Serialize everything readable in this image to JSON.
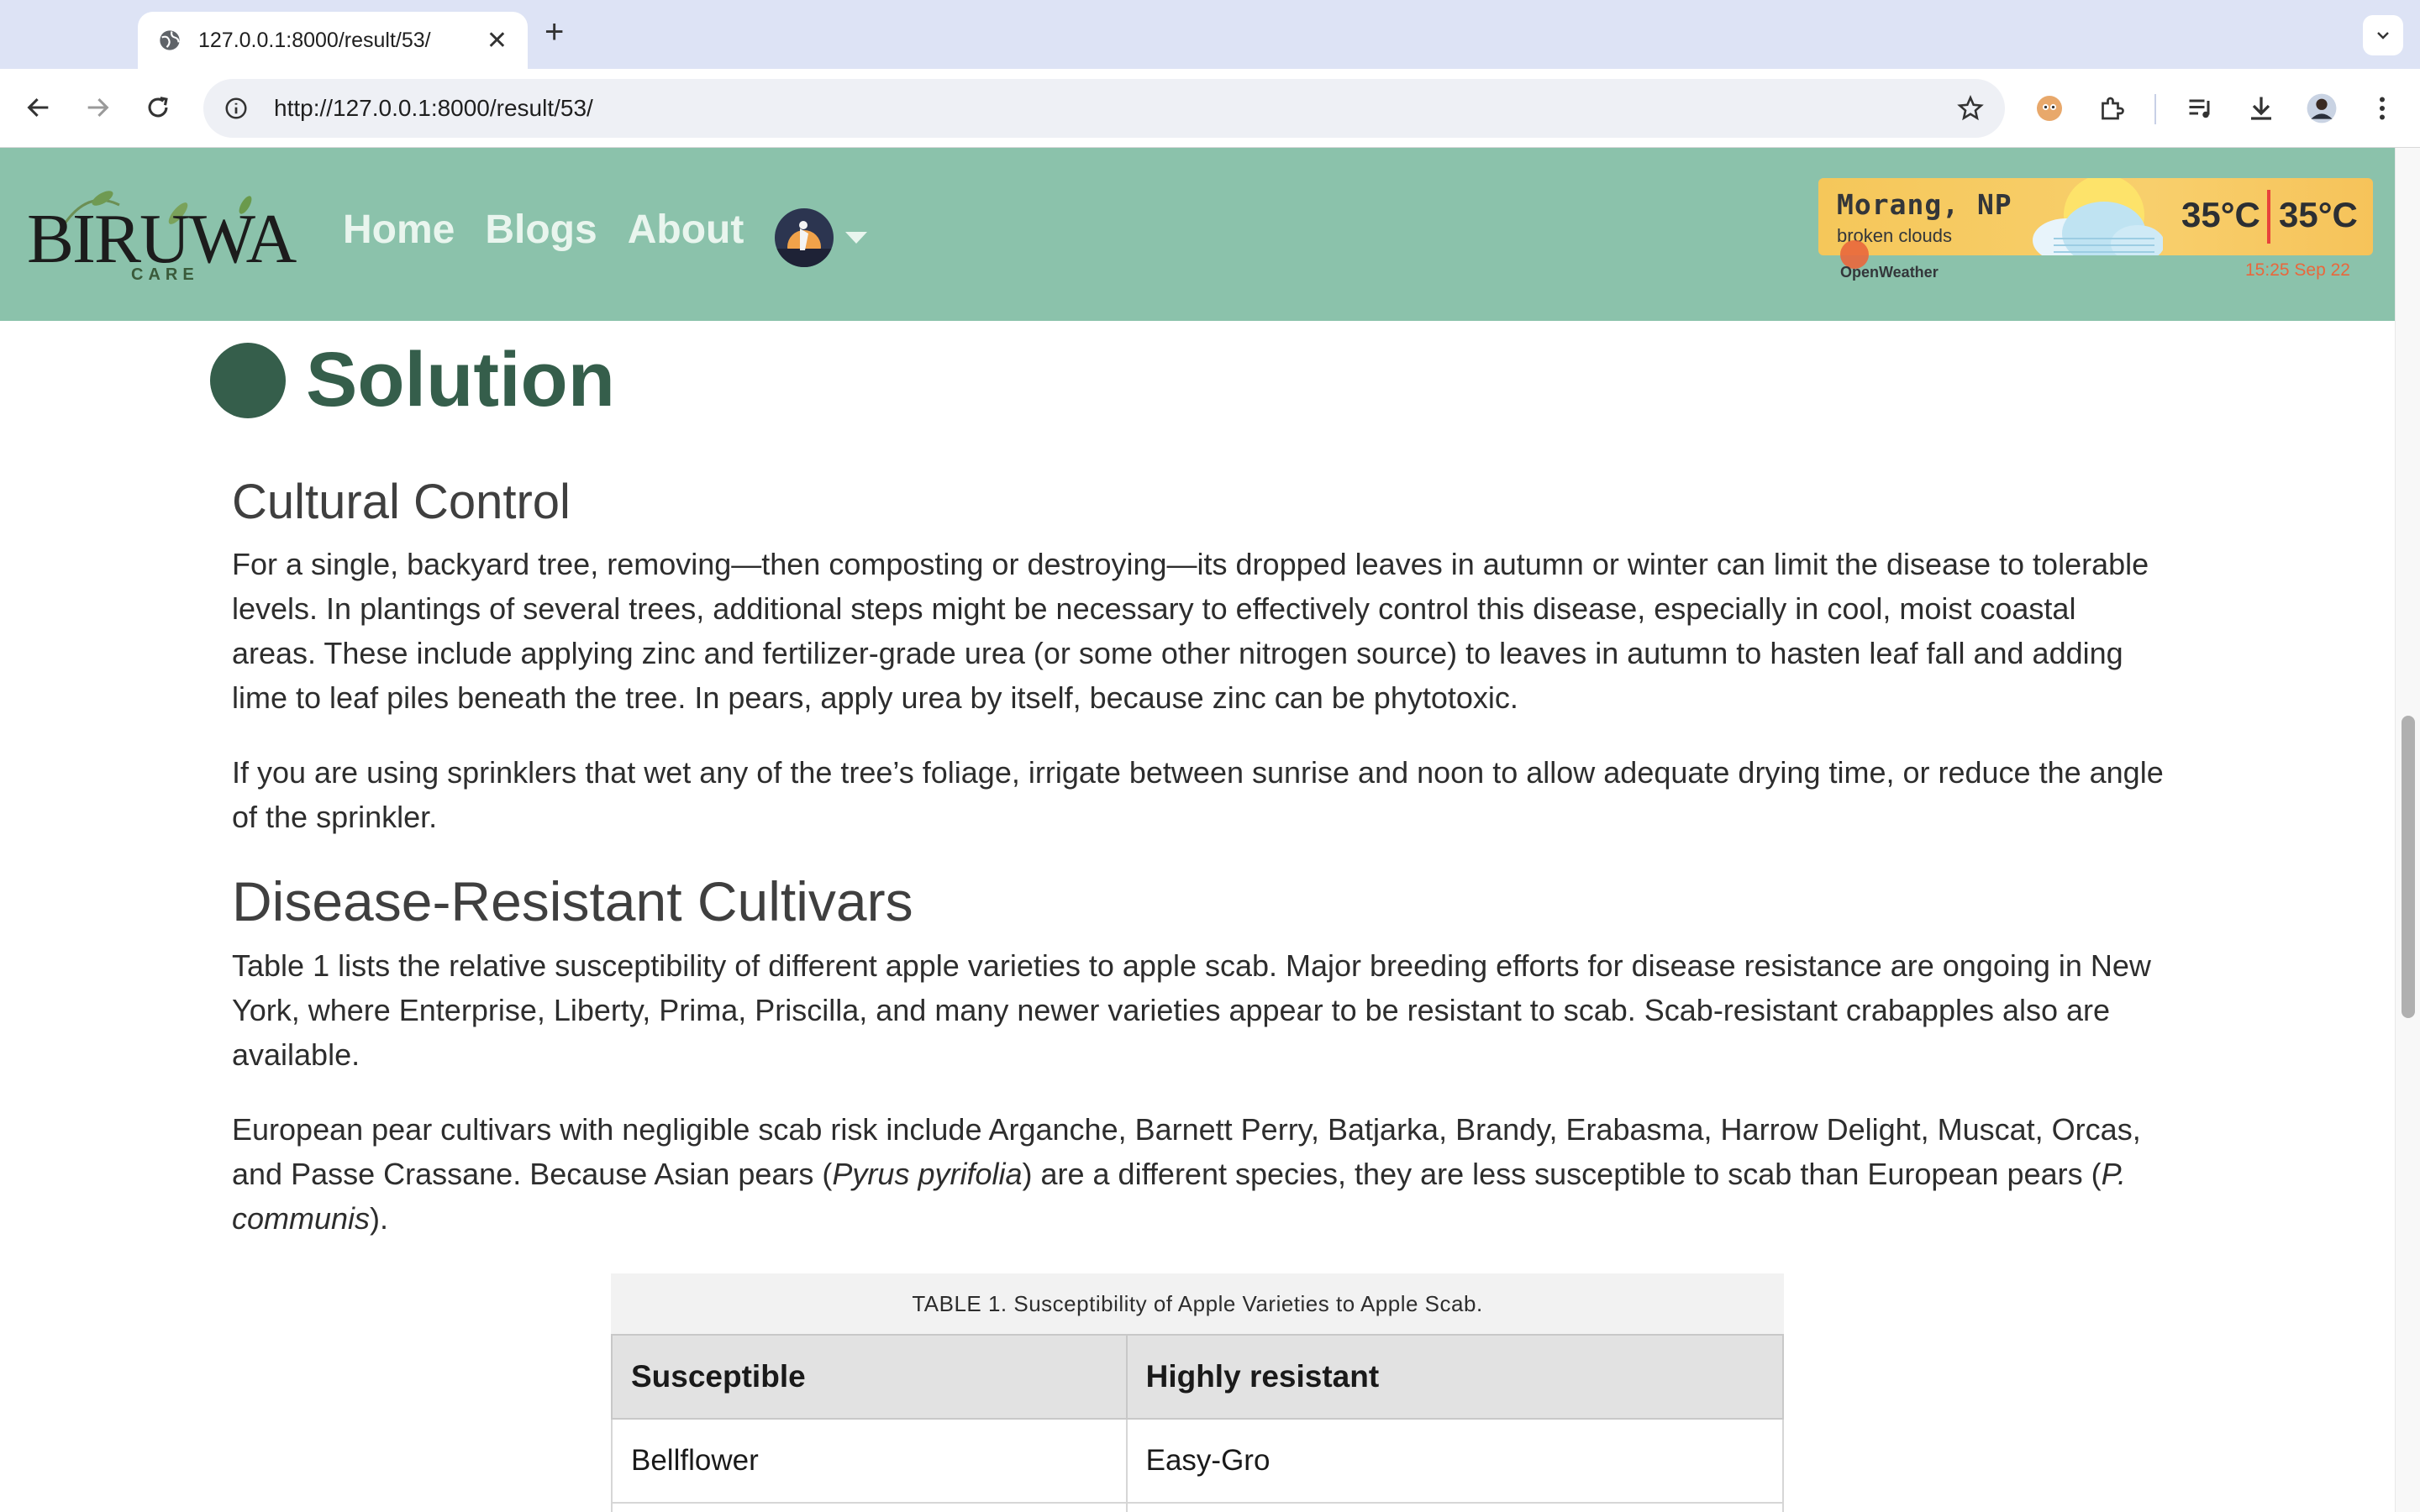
{
  "browser": {
    "tab_title": "127.0.0.1:8000/result/53/",
    "url": "http://127.0.0.1:8000/result/53/"
  },
  "header": {
    "logo_word": "BIRUWA",
    "logo_sub": "CARE",
    "nav": [
      {
        "label": "Home"
      },
      {
        "label": "Blogs"
      },
      {
        "label": "About"
      }
    ],
    "weather": {
      "city": "Morang, NP",
      "description": "broken clouds",
      "temp_primary": "35°C",
      "temp_secondary": "35°C",
      "provider": "OpenWeather",
      "time": "15:25 Sep 22"
    }
  },
  "content": {
    "section_title": "Solution",
    "cultural_heading": "Cultural Control",
    "cultural_p1": "For a single, backyard tree, removing—then composting or destroying—its dropped leaves in autumn or winter can limit the disease to tolerable levels. In plantings of several trees, additional steps might be necessary to effectively control this disease, especially in cool, moist coastal areas. These include applying zinc and fertilizer-grade urea (or some other nitrogen source) to leaves in autumn to hasten leaf fall and adding lime to leaf piles beneath the tree. In pears, apply urea by itself, because zinc can be phytotoxic.",
    "cultural_p2": "If you are using sprinklers that wet any of the tree’s foliage, irrigate between sunrise and noon to allow adequate drying time, or reduce the angle of the sprinkler.",
    "disease_heading": "Disease-Resistant Cultivars",
    "disease_p1": "Table 1 lists the relative susceptibility of different apple varieties to apple scab. Major breeding efforts for disease resistance are ongoing in New York, where Enterprise, Liberty, Prima, Priscilla, and many newer varieties appear to be resistant to scab. Scab-resistant crabapples also are available.",
    "disease_p2_a": "European pear cultivars with negligible scab risk include Arganche, Barnett Perry, Batjarka, Brandy, Erabasma, Harrow Delight, Muscat, Orcas, and Passe Crassane. Because Asian pears (",
    "disease_p2_em1": "Pyrus pyrifolia",
    "disease_p2_b": ") are a different species, they are less susceptible to scab than European pears (",
    "disease_p2_em2": "P. communis",
    "disease_p2_c": ").",
    "table": {
      "caption": "TABLE 1. Susceptibility of Apple Varieties to Apple Scab.",
      "headers": [
        "Susceptible",
        "Highly resistant"
      ],
      "rows": [
        [
          "Bellflower",
          "Easy-Gro"
        ]
      ]
    }
  },
  "colors": {
    "header_bg": "#8bc2ab",
    "accent": "#355e4b",
    "weather_bg": "#f7c965",
    "weather_divider": "#e8433b"
  }
}
